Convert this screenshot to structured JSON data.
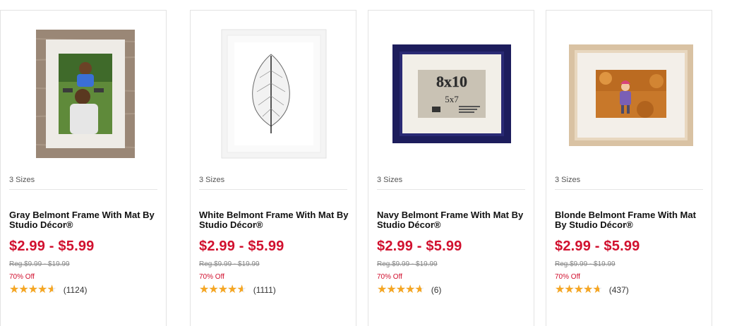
{
  "products": [
    {
      "image_name": "white-frame-leaf-image",
      "sizes": "3 Sizes",
      "title": "White Belmont Frame With Mat By Studio Décor®",
      "price": "$2.99 - $5.99",
      "reg_price": "Reg.$9.99 - $19.99",
      "discount": "70% Off",
      "rating_fraction": 0.93,
      "review_count": "(1111)"
    },
    {
      "image_name": "navy-frame-image",
      "image_text_top": "8x10",
      "image_text_mid": "5x7",
      "sizes": "3 Sizes",
      "title": "Navy Belmont Frame With Mat By Studio Décor®",
      "price": "$2.99 - $5.99",
      "reg_price": "Reg.$9.99 - $19.99",
      "discount": "70% Off",
      "rating_fraction": 0.94,
      "review_count": "(6)"
    },
    {
      "image_name": "blonde-frame-photo-image",
      "sizes": "3 Sizes",
      "title": "Blonde Belmont Frame With Mat By Studio Décor®",
      "price": "$2.99 - $5.99",
      "reg_price": "Reg.$9.99 - $19.99",
      "discount": "70% Off",
      "rating_fraction": 0.95,
      "review_count": "(437)"
    },
    {
      "image_name": "gray-frame-photo-image",
      "sizes": "3 Sizes",
      "title": "Gray Belmont Frame With Mat By Studio Décor®",
      "price": "$2.99 - $5.99",
      "reg_price": "Reg.$9.99 - $19.99",
      "discount": "70% Off",
      "rating_fraction": 0.93,
      "review_count": "(1124)"
    }
  ],
  "colors": {
    "price": "#d1102e",
    "star": "#f5a623",
    "navy_frame": "#1d1d5c",
    "blonde_frame": "#d9c2a3",
    "gray_frame": "#9a8776"
  }
}
